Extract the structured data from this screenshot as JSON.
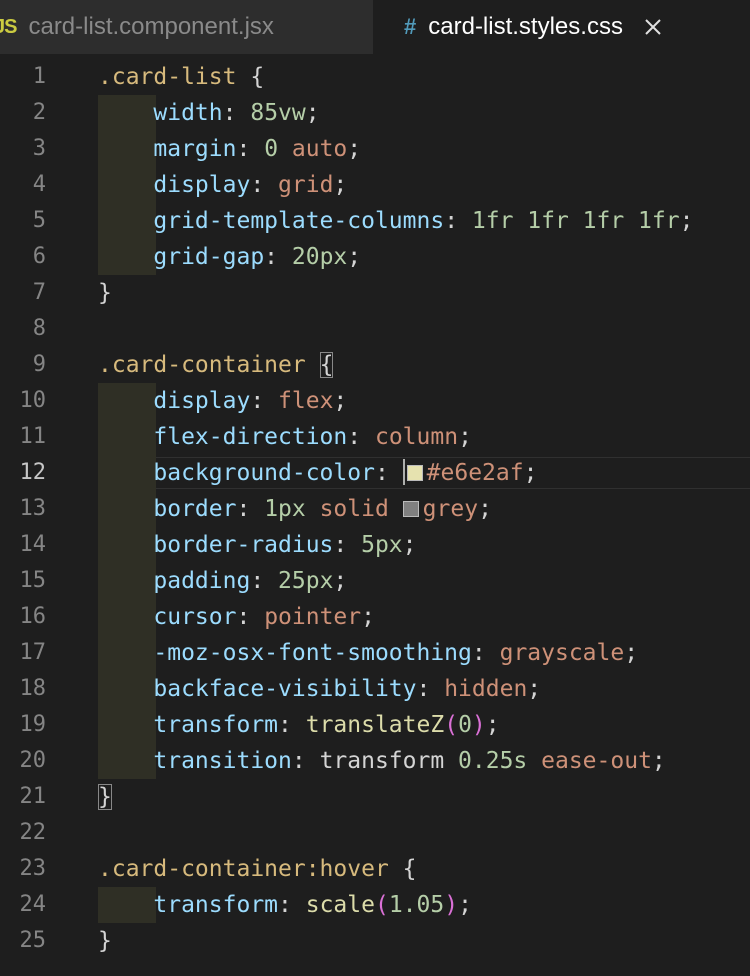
{
  "tabs": [
    {
      "icon_text": "JS",
      "label": "card-list.component.jsx",
      "active": false
    },
    {
      "icon_text": "#",
      "label": "card-list.styles.css",
      "active": true
    }
  ],
  "colors": {
    "background": "#1e1e1e",
    "swatch_card_bg": "#e6e2af",
    "swatch_border": "#808080"
  },
  "editor": {
    "active_line": 12,
    "lines": [
      {
        "n": "1",
        "indent": 0,
        "t": [
          [
            "sel",
            ".card-list "
          ],
          [
            "brace",
            "{"
          ]
        ]
      },
      {
        "n": "2",
        "indent": 1,
        "t": [
          [
            "prop",
            "width"
          ],
          [
            "punc",
            ": "
          ],
          [
            "num",
            "85vw"
          ],
          [
            "punc",
            ";"
          ]
        ]
      },
      {
        "n": "3",
        "indent": 1,
        "t": [
          [
            "prop",
            "margin"
          ],
          [
            "punc",
            ": "
          ],
          [
            "num",
            "0 "
          ],
          [
            "val",
            "auto"
          ],
          [
            "punc",
            ";"
          ]
        ]
      },
      {
        "n": "4",
        "indent": 1,
        "t": [
          [
            "prop",
            "display"
          ],
          [
            "punc",
            ": "
          ],
          [
            "val",
            "grid"
          ],
          [
            "punc",
            ";"
          ]
        ]
      },
      {
        "n": "5",
        "indent": 1,
        "t": [
          [
            "prop",
            "grid-template-columns"
          ],
          [
            "punc",
            ": "
          ],
          [
            "num",
            "1fr 1fr 1fr 1fr"
          ],
          [
            "punc",
            ";"
          ]
        ]
      },
      {
        "n": "6",
        "indent": 1,
        "t": [
          [
            "prop",
            "grid-gap"
          ],
          [
            "punc",
            ": "
          ],
          [
            "num",
            "20px"
          ],
          [
            "punc",
            ";"
          ]
        ]
      },
      {
        "n": "7",
        "indent": 0,
        "t": [
          [
            "brace",
            "}"
          ]
        ]
      },
      {
        "n": "8",
        "indent": 0,
        "t": []
      },
      {
        "n": "9",
        "indent": 0,
        "t": [
          [
            "sel",
            ".card-container "
          ],
          [
            "brace",
            "{"
          ]
        ]
      },
      {
        "n": "10",
        "indent": 1,
        "t": [
          [
            "prop",
            "display"
          ],
          [
            "punc",
            ": "
          ],
          [
            "val",
            "flex"
          ],
          [
            "punc",
            ";"
          ]
        ]
      },
      {
        "n": "11",
        "indent": 1,
        "t": [
          [
            "prop",
            "flex-direction"
          ],
          [
            "punc",
            ": "
          ],
          [
            "val",
            "column"
          ],
          [
            "punc",
            ";"
          ]
        ]
      },
      {
        "n": "12",
        "indent": 1,
        "t": [
          [
            "prop",
            "background-color"
          ],
          [
            "punc",
            ": "
          ],
          [
            "swatch",
            "#e6e2af"
          ],
          [
            "val",
            "#e6e2af"
          ],
          [
            "punc",
            ";"
          ]
        ]
      },
      {
        "n": "13",
        "indent": 1,
        "t": [
          [
            "prop",
            "border"
          ],
          [
            "punc",
            ": "
          ],
          [
            "num",
            "1px "
          ],
          [
            "val",
            "solid "
          ],
          [
            "swatch",
            "#808080"
          ],
          [
            "val",
            "grey"
          ],
          [
            "punc",
            ";"
          ]
        ]
      },
      {
        "n": "14",
        "indent": 1,
        "t": [
          [
            "prop",
            "border-radius"
          ],
          [
            "punc",
            ": "
          ],
          [
            "num",
            "5px"
          ],
          [
            "punc",
            ";"
          ]
        ]
      },
      {
        "n": "15",
        "indent": 1,
        "t": [
          [
            "prop",
            "padding"
          ],
          [
            "punc",
            ": "
          ],
          [
            "num",
            "25px"
          ],
          [
            "punc",
            ";"
          ]
        ]
      },
      {
        "n": "16",
        "indent": 1,
        "t": [
          [
            "prop",
            "cursor"
          ],
          [
            "punc",
            ": "
          ],
          [
            "val",
            "pointer"
          ],
          [
            "punc",
            ";"
          ]
        ]
      },
      {
        "n": "17",
        "indent": 1,
        "t": [
          [
            "prop",
            "-moz-osx-font-smoothing"
          ],
          [
            "punc",
            ": "
          ],
          [
            "val",
            "grayscale"
          ],
          [
            "punc",
            ";"
          ]
        ]
      },
      {
        "n": "18",
        "indent": 1,
        "t": [
          [
            "prop",
            "backface-visibility"
          ],
          [
            "punc",
            ": "
          ],
          [
            "val",
            "hidden"
          ],
          [
            "punc",
            ";"
          ]
        ]
      },
      {
        "n": "19",
        "indent": 1,
        "t": [
          [
            "prop",
            "transform"
          ],
          [
            "punc",
            ": "
          ],
          [
            "fn",
            "translateZ"
          ],
          [
            "paren",
            "("
          ],
          [
            "num",
            "0"
          ],
          [
            "paren",
            ")"
          ],
          [
            "punc",
            ";"
          ]
        ]
      },
      {
        "n": "20",
        "indent": 1,
        "t": [
          [
            "prop",
            "transition"
          ],
          [
            "punc",
            ": transform "
          ],
          [
            "num",
            "0.25s "
          ],
          [
            "val",
            "ease-out"
          ],
          [
            "punc",
            ";"
          ]
        ]
      },
      {
        "n": "21",
        "indent": 0,
        "t": [
          [
            "brace",
            "}"
          ]
        ]
      },
      {
        "n": "22",
        "indent": 0,
        "t": []
      },
      {
        "n": "23",
        "indent": 0,
        "t": [
          [
            "sel",
            ".card-container:hover "
          ],
          [
            "brace",
            "{"
          ]
        ]
      },
      {
        "n": "24",
        "indent": 1,
        "t": [
          [
            "prop",
            "transform"
          ],
          [
            "punc",
            ": "
          ],
          [
            "fn",
            "scale"
          ],
          [
            "paren",
            "("
          ],
          [
            "num",
            "1.05"
          ],
          [
            "paren",
            ")"
          ],
          [
            "punc",
            ";"
          ]
        ]
      },
      {
        "n": "25",
        "indent": 0,
        "t": [
          [
            "brace",
            "}"
          ]
        ]
      }
    ]
  }
}
